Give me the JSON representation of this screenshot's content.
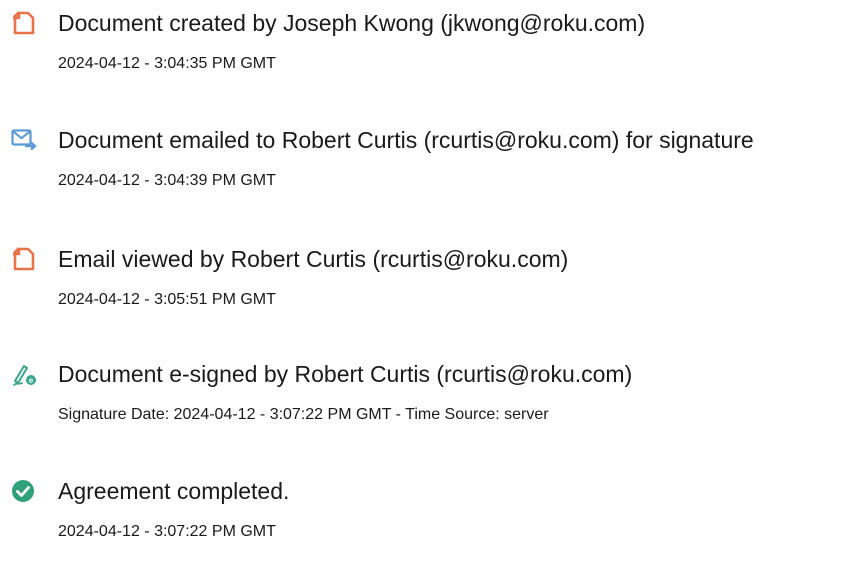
{
  "events": [
    {
      "icon": "document-created-icon",
      "title": "Document created by Joseph Kwong (jkwong@roku.com)",
      "timestamp": "2024-04-12 - 3:04:35 PM GMT"
    },
    {
      "icon": "email-sent-icon",
      "title": "Document emailed to Robert Curtis (rcurtis@roku.com) for signature",
      "timestamp": "2024-04-12 - 3:04:39 PM GMT"
    },
    {
      "icon": "document-viewed-icon",
      "title": "Email viewed by Robert Curtis (rcurtis@roku.com)",
      "timestamp": "2024-04-12 - 3:05:51 PM GMT"
    },
    {
      "icon": "e-signature-icon",
      "title": "Document e-signed by Robert Curtis (rcurtis@roku.com)",
      "timestamp": "Signature Date: 2024-04-12 - 3:07:22 PM GMT - Time Source: server"
    },
    {
      "icon": "agreement-completed-icon",
      "title": "Agreement completed.",
      "timestamp": "2024-04-12 - 3:07:22 PM GMT"
    }
  ],
  "colors": {
    "document_icon": "#e8734a",
    "email_icon": "#5b9bd5",
    "signature_icon": "#3aa58c",
    "completed_icon": "#2fa07a",
    "text": "#1a1a1a"
  }
}
